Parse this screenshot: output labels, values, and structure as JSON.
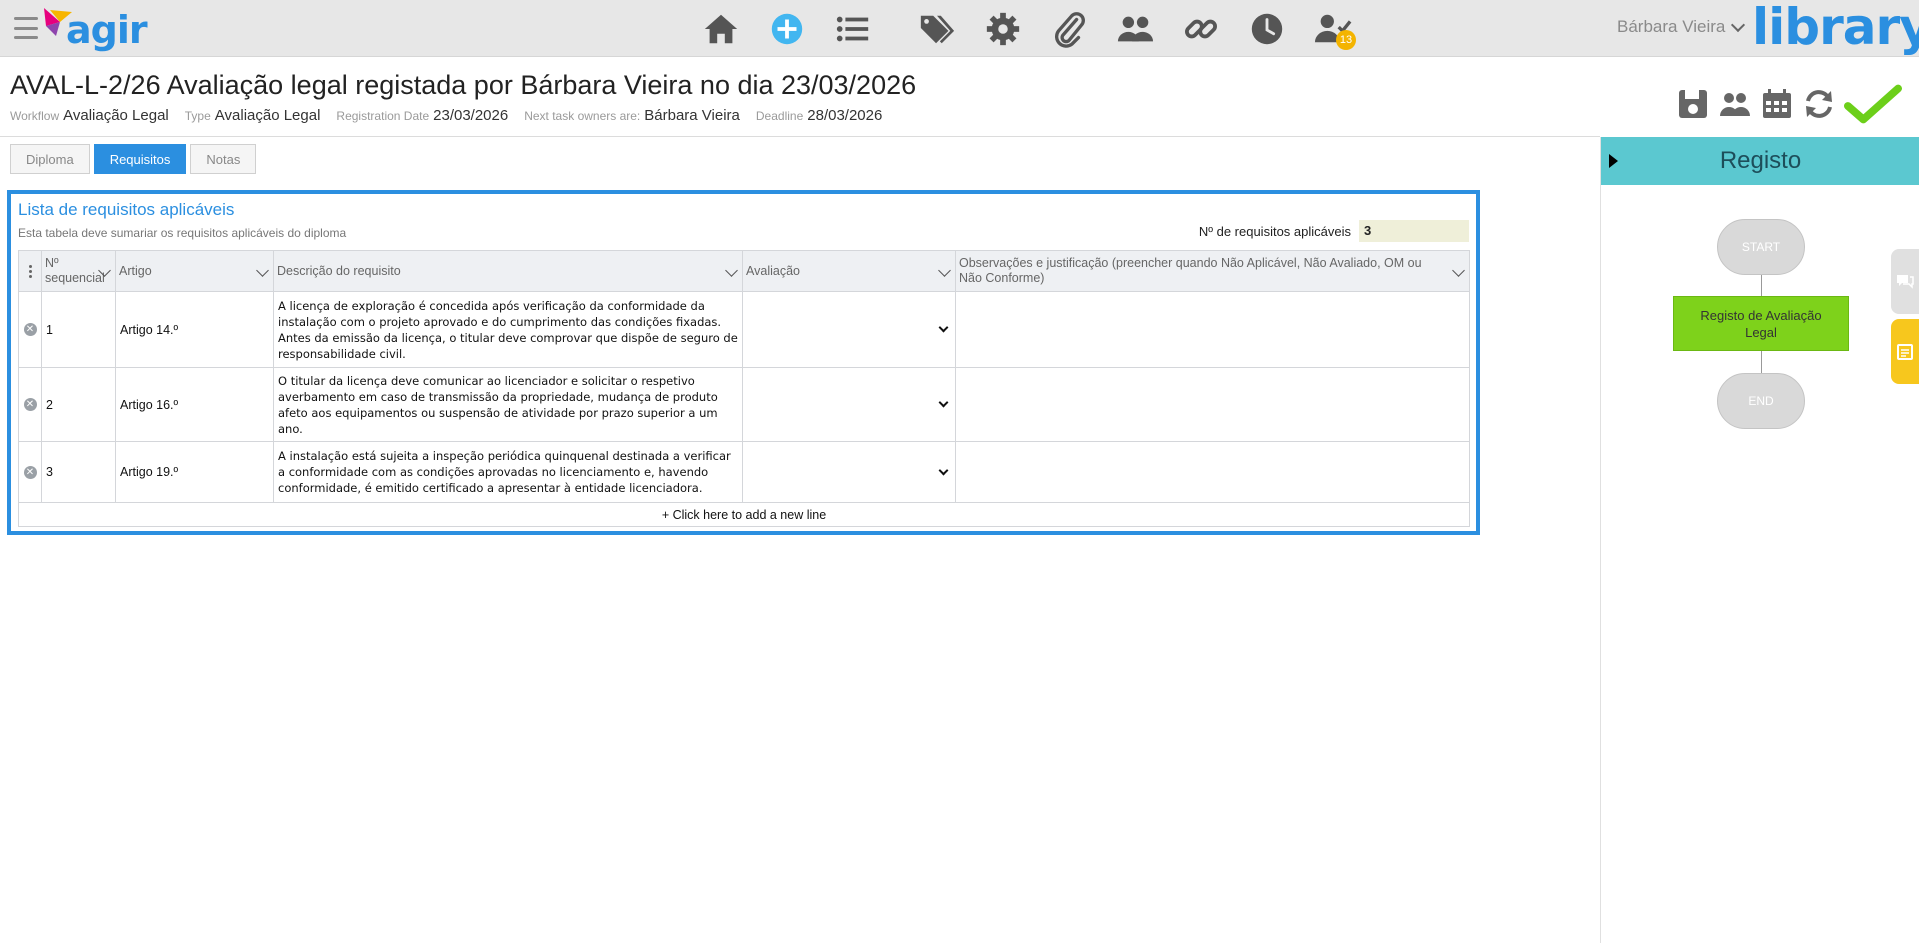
{
  "app": {
    "logo_text": "agir",
    "library_text": "library",
    "user_name": "Bárbara Vieira",
    "notification_count": "13"
  },
  "nav": {
    "icons": [
      "home-icon",
      "add-icon",
      "list-icon",
      "tags-icon",
      "settings-icon",
      "attachment-icon",
      "users-icon",
      "link-icon",
      "clock-icon",
      "user-check-icon"
    ]
  },
  "header": {
    "title": "AVAL-L-2/26 Avaliação legal registada por Bárbara Vieira no dia 23/03/2026",
    "workflow_label": "Workflow",
    "workflow_value": "Avaliação Legal",
    "type_label": "Type",
    "type_value": "Avaliação Legal",
    "reg_label": "Registration Date",
    "reg_value": "23/03/2026",
    "owners_label": "Next task owners are:",
    "owners_value": "Bárbara Vieira",
    "deadline_label": "Deadline",
    "deadline_value": "28/03/2026"
  },
  "tabs": [
    {
      "label": "Diploma"
    },
    {
      "label": "Requisitos"
    },
    {
      "label": "Notas"
    }
  ],
  "panel": {
    "title": "Lista de requisitos aplicáveis",
    "subtitle": "Esta tabela deve sumariar os requisitos aplicáveis do diploma",
    "count_label": "Nº de requisitos aplicáveis",
    "count_value": "3"
  },
  "table": {
    "headers": [
      "Nº sequencial",
      "Artigo",
      "Descrição do requisito",
      "Avaliação",
      "Observações e justificação (preencher quando Não Aplicável, Não Avaliado, OM ou Não Conforme)"
    ],
    "rows": [
      {
        "seq": "1",
        "artigo": "Artigo 14.º",
        "descricao": "A licença de exploração é concedida após verificação da conformidade da instalação com o projeto aprovado e do cumprimento das condições fixadas. Antes da emissão da licença, o titular deve comprovar que dispõe de seguro de responsabilidade civil.",
        "avaliacao": "",
        "observacoes": ""
      },
      {
        "seq": "2",
        "artigo": "Artigo 16.º",
        "descricao": "O titular da licença deve comunicar ao licenciador e solicitar o respetivo averbamento em caso de transmissão da propriedade, mudança de produto afeto aos equipamentos ou suspensão de atividade por prazo superior a um ano.",
        "avaliacao": "",
        "observacoes": ""
      },
      {
        "seq": "3",
        "artigo": "Artigo 19.º",
        "descricao": "A instalação está sujeita a inspeção periódica quinquenal destinada a verificar a conformidade com as condições aprovadas no licenciamento e, havendo conformidade, é emitido certificado a apresentar à entidade licenciadora.",
        "avaliacao": "",
        "observacoes": ""
      }
    ],
    "add_line": "+ Click here to add a new line"
  },
  "workflow_panel": {
    "title": "Registo",
    "start": "START",
    "step": "Registo de Avaliação Legal",
    "end": "END"
  },
  "colors": {
    "accent": "#2b8fe0",
    "panel_header": "#5bc8d0",
    "step_green": "#7ed21b",
    "confirm_green": "#6ccf1a"
  }
}
